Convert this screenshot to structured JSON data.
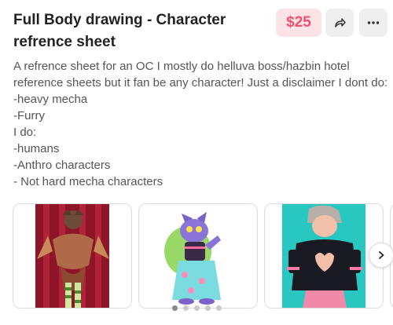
{
  "listing": {
    "title": "Full Body drawing - Character refrence sheet",
    "price": "$25",
    "description_lines": [
      "A refrence sheet for an OC I mostly do helluva boss/hazbin hotel",
      "reference sheets but it fan be any character! Just a disclaimer I dont do:",
      "-heavy mecha",
      "-Furry",
      "I do:",
      "-humans",
      "-Anthro characters",
      "- Not hard mecha characters"
    ]
  },
  "actions": {
    "share_icon": "share-arrow-icon",
    "more_icon": "more-dots-icon"
  },
  "gallery": {
    "images": [
      {
        "subject": "moth-character-on-red-striped-background"
      },
      {
        "subject": "blue-cat-character-with-green-blob"
      },
      {
        "subject": "character-with-heart-cutout-on-cyan-background"
      }
    ],
    "next_icon": "chevron-right-icon",
    "dot_count": 5,
    "active_dot": 0
  },
  "colors": {
    "price_text": "#f0506e",
    "price_bg": "#fde2e6"
  }
}
